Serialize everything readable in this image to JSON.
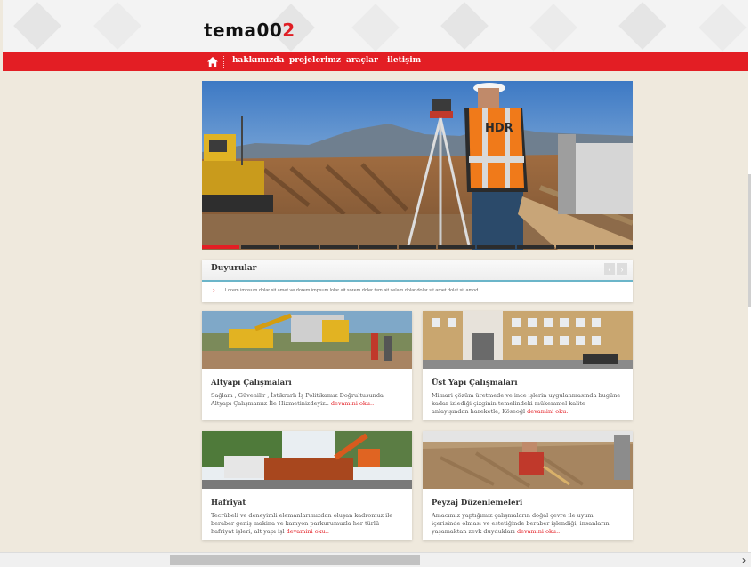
{
  "header": {
    "logo_main": "tema00",
    "logo_accent": "2"
  },
  "nav": {
    "items": [
      "hakkımızda",
      "projelerimz",
      "araçlar",
      "iletişim"
    ]
  },
  "slider": {
    "slide_count": 11,
    "active_index": 0,
    "vest_text": "HDR"
  },
  "announcements": {
    "title": "Duyurular",
    "text": "Lorem impsum dolar sit amet ve dorem impsum lolar ait sorem doler tem ait selam dolar dolar sit amet dolat sit amod.",
    "prev": "‹",
    "next": "›"
  },
  "cards": [
    {
      "title": "Altyapı Çalışmaları",
      "body": "Sağlam , Güvenilir , İstikrarlı İş Politikamız Doğrultusunda Altyapı Çalışmamız İle Hizmetinizdeyiz..",
      "more": "devamini oku.."
    },
    {
      "title": "Üst Yapı Çalışmaları",
      "body": "Mimari çözüm üretmede ve ince işlerin uygulanmasında bugüne kadar izlediği çizginin temelindeki mükemmel kalite anlayışından hareketle, Köseoğl",
      "more": "devamini oku.."
    },
    {
      "title": "Hafriyat",
      "body": "Tecrübeli ve deneyimli elemanlarımızdan oluşan kadromuz ile beraber geniş makina ve kamyon parkurumuzla her türlü hafriyat işleri, alt yapı işl",
      "more": "devamini oku.."
    },
    {
      "title": "Peyzaj Düzenlemeleri",
      "body": "Amacımız yaptığımız çalışmaların doğal çevre ile uyum içerisinde olması ve estetiğinde beraber işlendiği, insanların yaşamaktan zevk duydukları",
      "more": "devamini oku.."
    }
  ],
  "colors": {
    "accent": "#e31e24",
    "background": "#efe9dd",
    "announcement_rule": "#6bb5c9"
  },
  "scrollbar": {
    "right_arrow": "›"
  }
}
